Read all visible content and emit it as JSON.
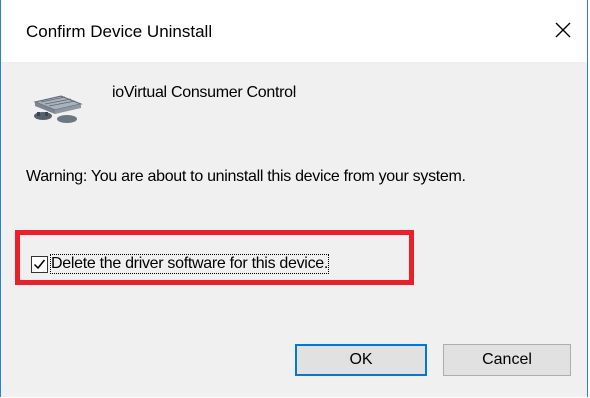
{
  "dialog": {
    "title": "Confirm Device Uninstall",
    "close_icon": "close-icon",
    "device_icon": "device-icon",
    "device_name": "ioVirtual Consumer Control",
    "warning": "Warning: You are about to uninstall this device from your system.",
    "delete_driver": {
      "label": "Delete the driver software for this device.",
      "checked": true
    },
    "buttons": {
      "ok_label": "OK",
      "cancel_label": "Cancel"
    }
  },
  "colors": {
    "highlight": "#e8202a",
    "accent": "#0078d7",
    "client_bg": "#f0f0f0"
  }
}
